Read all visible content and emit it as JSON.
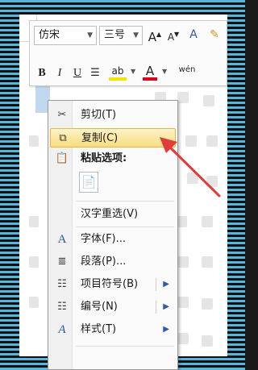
{
  "toolbar": {
    "font_name": "仿宋",
    "font_size": "三号",
    "grow_font": "A",
    "shrink_font": "A",
    "format_painter": "A",
    "bold": "B",
    "italic": "I",
    "underline": "U",
    "highlight": "ab",
    "font_color": "A",
    "phonetic": "wén"
  },
  "context_menu": {
    "items": [
      {
        "label": "剪切(T)",
        "icon": "scissors-icon"
      },
      {
        "label": "复制(C)",
        "icon": "copy-icon"
      },
      {
        "label": "粘贴选项:",
        "icon": "clipboard-icon"
      },
      {
        "label": "汉字重选(V)",
        "icon": ""
      },
      {
        "label": "字体(F)...",
        "icon": "font-icon"
      },
      {
        "label": "段落(P)...",
        "icon": "paragraph-icon"
      },
      {
        "label": "项目符号(B)",
        "icon": "bullets-icon"
      },
      {
        "label": "编号(N)",
        "icon": "numbering-icon"
      },
      {
        "label": "样式(T)",
        "icon": "styles-icon"
      }
    ]
  },
  "colors": {
    "highlight": "#f2e600",
    "font_color": "#e0001a",
    "arrow": "#e23b3b",
    "menu_hover": "#f8dc7e"
  }
}
